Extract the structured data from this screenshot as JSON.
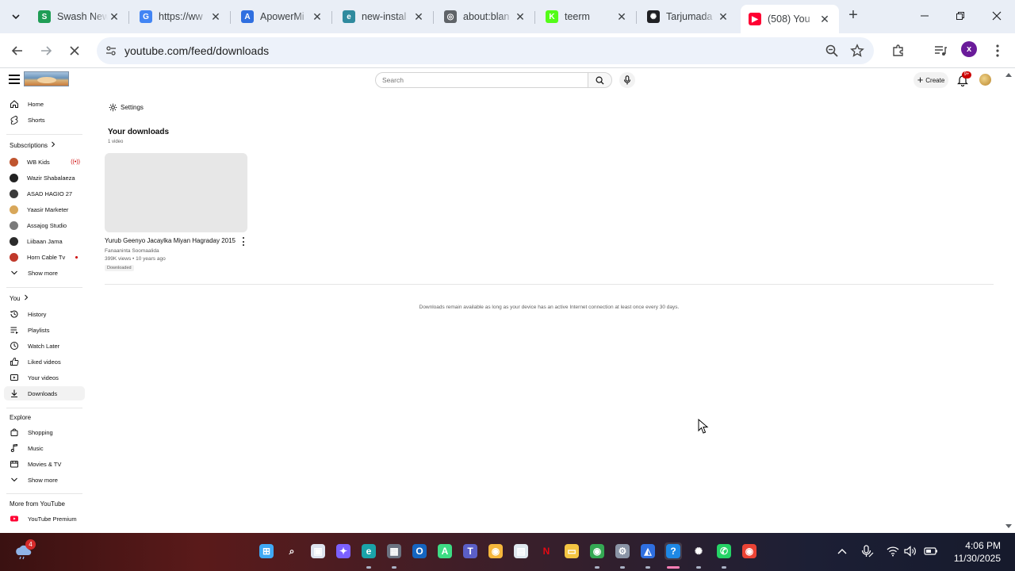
{
  "browser": {
    "tabs": [
      {
        "title": "Swash New",
        "favicon": "swash-icon",
        "color": "#1f9d55"
      },
      {
        "title": "https://ww",
        "favicon": "google-icon",
        "color": "#4285f4"
      },
      {
        "title": "ApowerMi",
        "favicon": "apowermirror-icon",
        "color": "#2f6fe0"
      },
      {
        "title": "new-instal",
        "favicon": "edge-like-icon",
        "color": "#2f8a9e"
      },
      {
        "title": "about:blan",
        "favicon": "globe-icon",
        "color": "#5f6368"
      },
      {
        "title": "teerm",
        "favicon": "kick-icon",
        "color": "#53fc18"
      },
      {
        "title": "Tarjumada",
        "favicon": "chatgpt-icon",
        "color": "#202124"
      },
      {
        "title": "(508) You",
        "favicon": "youtube-icon",
        "color": "#ff0033"
      }
    ],
    "active_tab_index": 7,
    "url": "youtube.com/feed/downloads",
    "profile_initial": "x"
  },
  "youtube": {
    "search_placeholder": "Search",
    "create_label": "Create",
    "notification_count": "9+",
    "sidebar": {
      "primary": [
        {
          "label": "Home",
          "icon": "home-icon"
        },
        {
          "label": "Shorts",
          "icon": "shorts-icon"
        }
      ],
      "subscriptions_label": "Subscriptions",
      "subscriptions": [
        {
          "label": "WB Kids",
          "color": "#c0552f",
          "status": "live"
        },
        {
          "label": "Wazir Shabalaeza",
          "color": "#222222",
          "status": ""
        },
        {
          "label": "ASAD HAGIO 27",
          "color": "#3a3a3a",
          "status": ""
        },
        {
          "label": "Yaasir Marketer",
          "color": "#d8a75a",
          "status": ""
        },
        {
          "label": "Assajog Studio",
          "color": "#7a7a7a",
          "status": ""
        },
        {
          "label": "Liibaan Jama",
          "color": "#2b2b2b",
          "status": ""
        },
        {
          "label": "Horn Cable Tv",
          "color": "#c0392b",
          "status": "dot"
        }
      ],
      "subscriptions_more": "Show more",
      "you_label": "You",
      "you_items": [
        {
          "label": "History",
          "icon": "history-icon"
        },
        {
          "label": "Playlists",
          "icon": "playlists-icon"
        },
        {
          "label": "Watch Later",
          "icon": "watch-later-icon"
        },
        {
          "label": "Liked videos",
          "icon": "like-icon"
        },
        {
          "label": "Your videos",
          "icon": "your-videos-icon"
        },
        {
          "label": "Downloads",
          "icon": "download-icon"
        }
      ],
      "explore_label": "Explore",
      "explore_items": [
        {
          "label": "Shopping",
          "icon": "shopping-icon"
        },
        {
          "label": "Music",
          "icon": "music-icon"
        },
        {
          "label": "Movies & TV",
          "icon": "movies-icon"
        }
      ],
      "explore_more": "Show more",
      "more_label": "More from YouTube",
      "more_items": [
        {
          "label": "YouTube Premium",
          "icon": "youtube-premium-icon"
        }
      ]
    },
    "main": {
      "settings_label": "Settings",
      "title": "Your downloads",
      "count": "1 video",
      "video": {
        "title": "Yurub Geenyo Jacaylka Miyan Hagraday 2015",
        "channel": "Fanaaninta Soomaalida",
        "meta": "399K views • 10 years ago",
        "badge": "Downloaded"
      },
      "notice": "Downloads remain available as long as your device has an active Internet connection at least once every 30 days."
    }
  },
  "taskbar": {
    "weather_badge": "4",
    "apps": [
      "windows-start-icon",
      "search-icon",
      "task-view-icon",
      "copilot-icon",
      "edge-icon",
      "calculator-icon",
      "outlook-icon",
      "android-studio-icon",
      "teams-icon",
      "chrome-canary-icon",
      "notepad-icon",
      "netflix-icon",
      "file-explorer-icon",
      "chrome-icon",
      "settings-icon",
      "apowermirror-icon",
      "help-icon",
      "chatgpt-icon",
      "whatsapp-icon",
      "chrome-alt-icon"
    ],
    "active_app_index": 16,
    "time": "4:06 PM",
    "date": "11/30/2025"
  }
}
